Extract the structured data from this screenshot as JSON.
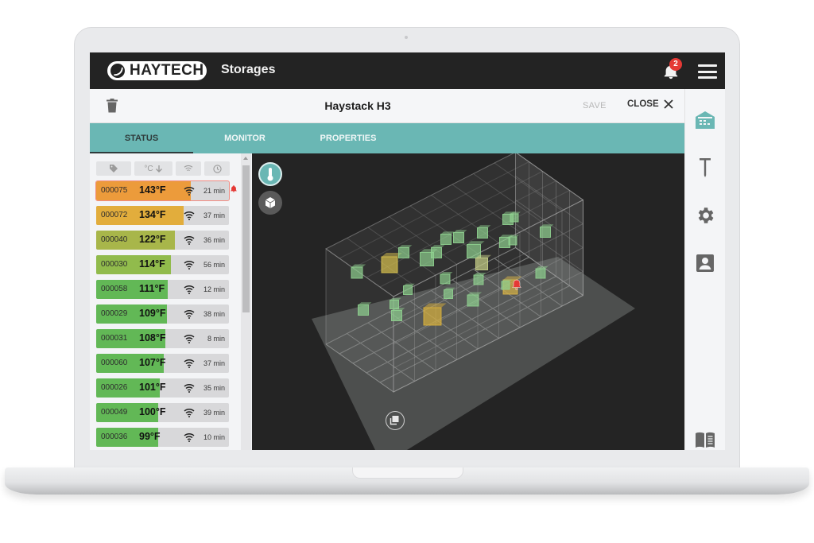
{
  "app": {
    "logo_text": "HAYTECH",
    "section_title": "Storages",
    "notification_count": "2"
  },
  "panel": {
    "title": "Haystack H3",
    "save_label": "SAVE",
    "close_label": "CLOSE"
  },
  "tabs": [
    {
      "label": "STATUS",
      "active": true
    },
    {
      "label": "MONITOR",
      "active": false
    },
    {
      "label": "PROPERTIES",
      "active": false
    }
  ],
  "list_headers": {
    "tag": "tag-icon",
    "temperature": "°C",
    "sort": "arrow-down-icon",
    "signal": "wifi-icon",
    "time": "clock-icon"
  },
  "sensors": [
    {
      "id": "000075",
      "temp": "143°F",
      "age": "21 min",
      "fill": 0.71,
      "color": "#ec9b3b",
      "alert": true
    },
    {
      "id": "000072",
      "temp": "134°F",
      "age": "37 min",
      "fill": 0.66,
      "color": "#e2ad3c",
      "alert": false
    },
    {
      "id": "000040",
      "temp": "122°F",
      "age": "36 min",
      "fill": 0.59,
      "color": "#a8b64a",
      "alert": false
    },
    {
      "id": "000030",
      "temp": "114°F",
      "age": "56 min",
      "fill": 0.56,
      "color": "#91bb4c",
      "alert": false
    },
    {
      "id": "000058",
      "temp": "111°F",
      "age": "12 min",
      "fill": 0.54,
      "color": "#62b856",
      "alert": false
    },
    {
      "id": "000029",
      "temp": "109°F",
      "age": "38 min",
      "fill": 0.53,
      "color": "#62b856",
      "alert": false
    },
    {
      "id": "000031",
      "temp": "108°F",
      "age": "8 min",
      "fill": 0.52,
      "color": "#62b856",
      "alert": false
    },
    {
      "id": "000060",
      "temp": "107°F",
      "age": "37 min",
      "fill": 0.51,
      "color": "#62b856",
      "alert": false
    },
    {
      "id": "000026",
      "temp": "101°F",
      "age": "35 min",
      "fill": 0.48,
      "color": "#62b856",
      "alert": false
    },
    {
      "id": "000049",
      "temp": "100°F",
      "age": "39 min",
      "fill": 0.47,
      "color": "#62b856",
      "alert": false
    },
    {
      "id": "000036",
      "temp": "99°F",
      "age": "10 min",
      "fill": 0.47,
      "color": "#62b856",
      "alert": false
    }
  ],
  "view3d": {
    "mode_buttons": [
      "thermometer-icon",
      "cube-icon"
    ],
    "layers_button": "layers-icon"
  },
  "rail": {
    "items": [
      "warehouse-icon",
      "probe-icon",
      "gear-icon",
      "contact-icon",
      "manual-book-icon"
    ],
    "active": "warehouse-icon"
  },
  "colors": {
    "accent": "#6ab7b4",
    "topbar": "#232323",
    "alert": "#e53935",
    "hot": "#ec9b3b",
    "warm": "#e2ad3c",
    "ok": "#62b856"
  }
}
